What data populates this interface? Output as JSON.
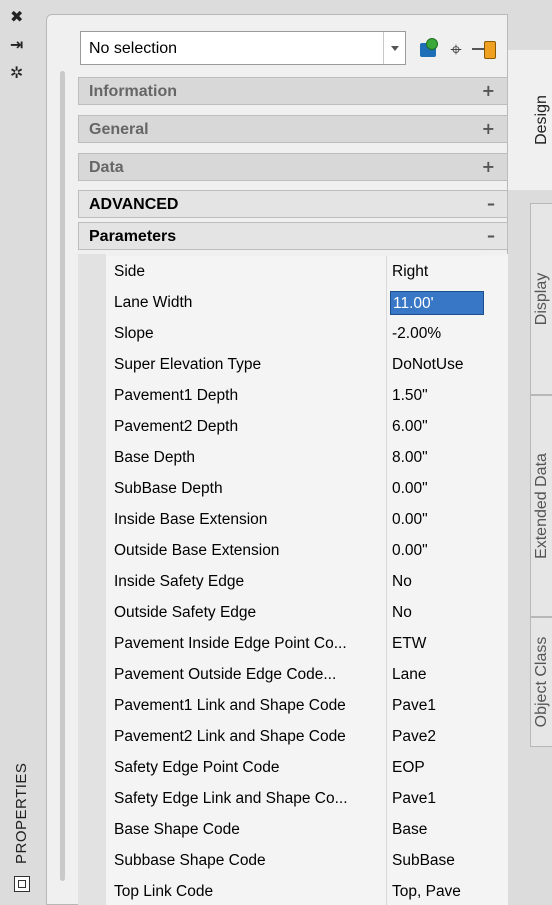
{
  "left_strip": {
    "close_glyph": "✖",
    "autohide_glyph": "⇥",
    "settings_glyph": "✲",
    "title": "PROPERTIES"
  },
  "selector": {
    "value": "No selection"
  },
  "toolbar": {
    "pick_glyph": "⌖"
  },
  "categories": {
    "information": {
      "label": "Information",
      "toggle": "+"
    },
    "general": {
      "label": "General",
      "toggle": "+"
    },
    "data": {
      "label": "Data",
      "toggle": "+"
    },
    "advanced": {
      "label": "ADVANCED",
      "toggle": "–"
    },
    "parameters": {
      "label": "Parameters",
      "toggle": "–"
    }
  },
  "parameters": [
    {
      "name": "Side",
      "value": "Right"
    },
    {
      "name": "Lane Width",
      "value": "11.00'"
    },
    {
      "name": "Slope",
      "value": "-2.00%"
    },
    {
      "name": "Super Elevation Type",
      "value": "DoNotUse"
    },
    {
      "name": "Pavement1 Depth",
      "value": "1.50\""
    },
    {
      "name": "Pavement2 Depth",
      "value": "6.00\""
    },
    {
      "name": "Base Depth",
      "value": "8.00\""
    },
    {
      "name": "SubBase Depth",
      "value": "0.00\""
    },
    {
      "name": "Inside Base Extension",
      "value": "0.00\""
    },
    {
      "name": "Outside Base Extension",
      "value": "0.00\""
    },
    {
      "name": "Inside Safety Edge",
      "value": "No"
    },
    {
      "name": "Outside Safety Edge",
      "value": "No"
    },
    {
      "name": "Pavement Inside Edge Point Co...",
      "value": "ETW"
    },
    {
      "name": "Pavement Outside Edge Code...",
      "value": "Lane"
    },
    {
      "name": "Pavement1 Link and Shape Code",
      "value": "Pave1"
    },
    {
      "name": "Pavement2 Link and Shape Code",
      "value": "Pave2"
    },
    {
      "name": "Safety Edge Point Code",
      "value": "EOP"
    },
    {
      "name": "Safety Edge Link and Shape Co...",
      "value": "Pave1"
    },
    {
      "name": "Base Shape Code",
      "value": "Base"
    },
    {
      "name": "Subbase Shape Code",
      "value": "SubBase"
    },
    {
      "name": "Top Link Code",
      "value": "Top, Pave"
    }
  ],
  "active_parameter_index": 1,
  "tabs": {
    "design": "Design",
    "display": "Display",
    "extended_data": "Extended Data",
    "object_class": "Object Class"
  }
}
